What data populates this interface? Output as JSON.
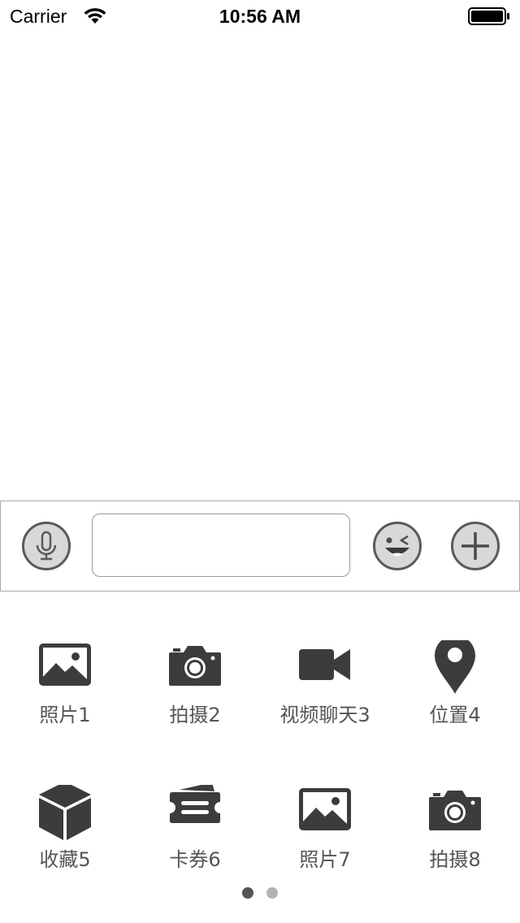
{
  "status_bar": {
    "carrier": "Carrier",
    "time": "10:56 AM"
  },
  "input_bar": {
    "text_value": "",
    "icons": [
      "microphone-icon",
      "emoji-icon",
      "plus-icon"
    ]
  },
  "actions": [
    {
      "label": "照片1",
      "icon": "photo-icon"
    },
    {
      "label": "拍摄2",
      "icon": "camera-icon"
    },
    {
      "label": "视频聊天3",
      "icon": "video-icon"
    },
    {
      "label": "位置4",
      "icon": "location-pin-icon"
    },
    {
      "label": "收藏5",
      "icon": "cube-icon"
    },
    {
      "label": "卡券6",
      "icon": "ticket-icon"
    },
    {
      "label": "照片7",
      "icon": "photo-icon"
    },
    {
      "label": "拍摄8",
      "icon": "camera-icon"
    }
  ],
  "pager": {
    "pages": 2,
    "current": 1
  },
  "colors": {
    "icon": "#3c3c3c",
    "label": "#555555",
    "border": "#a8a8a8"
  }
}
